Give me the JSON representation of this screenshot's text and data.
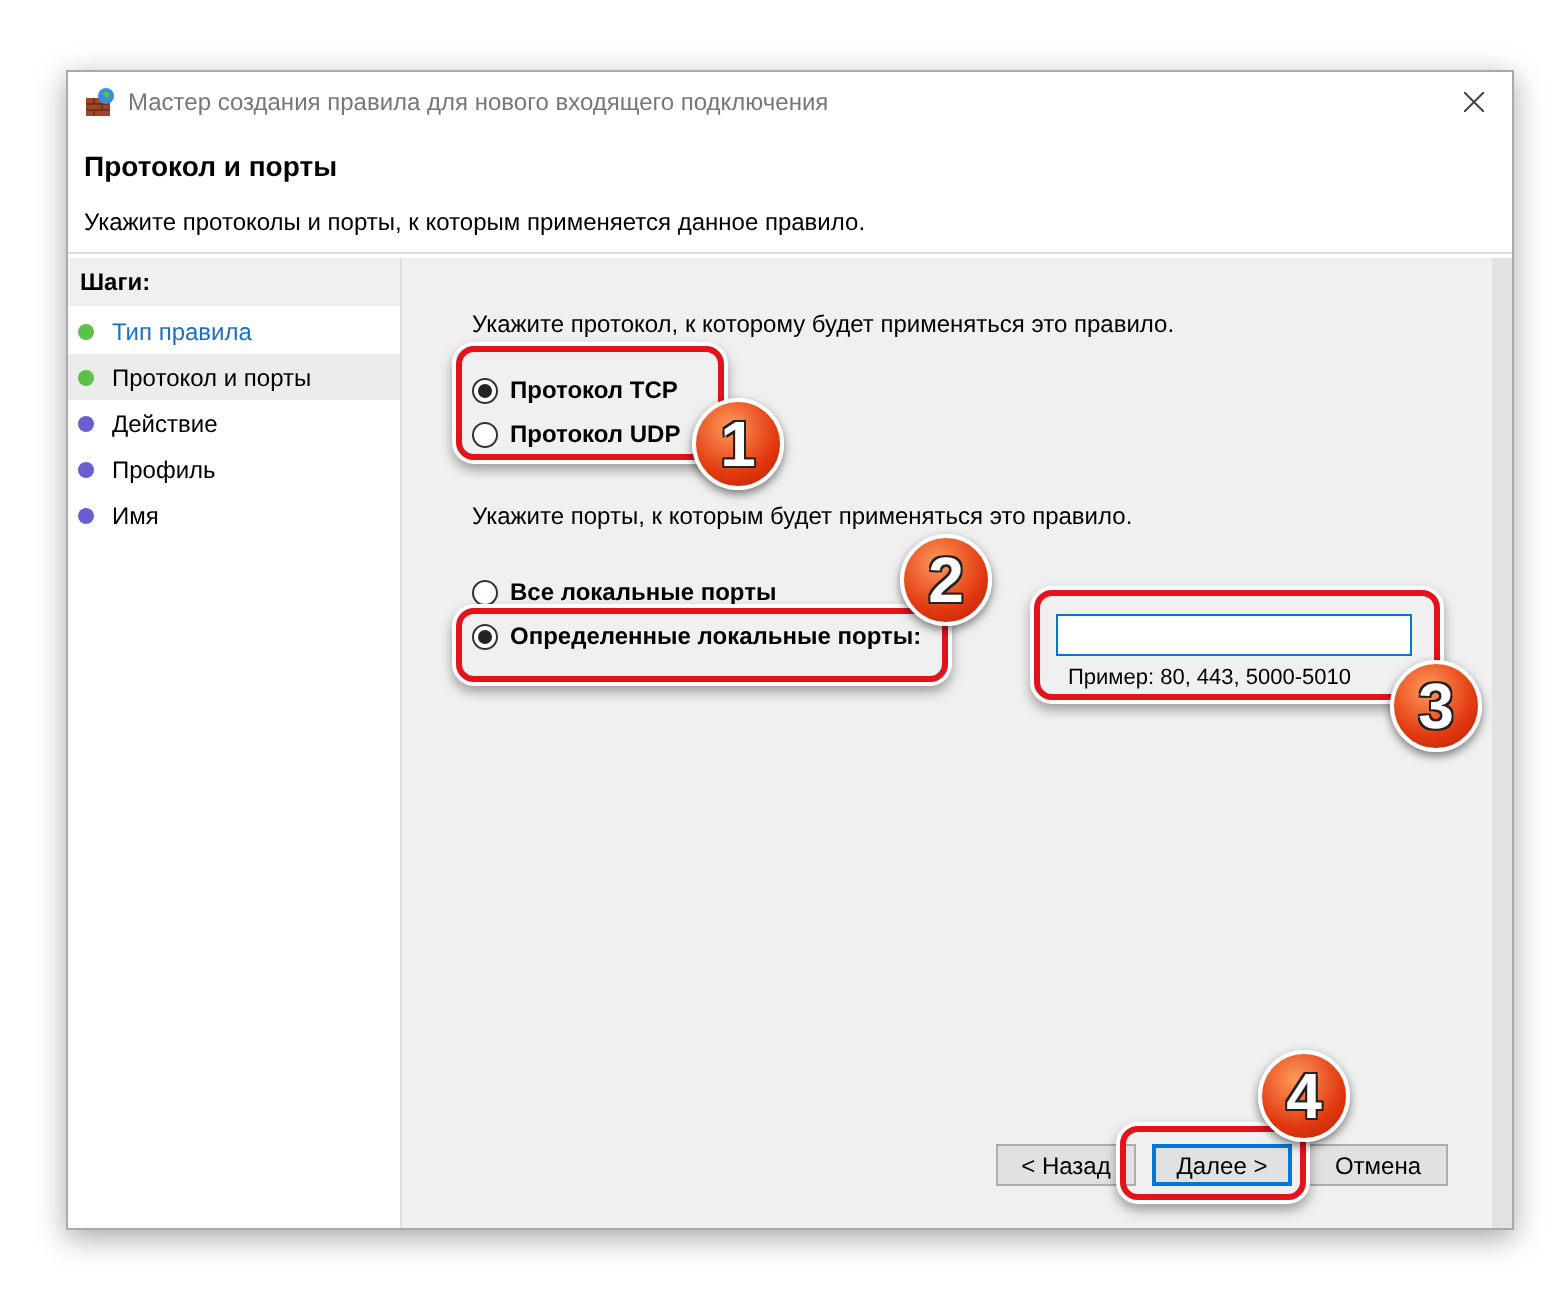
{
  "window": {
    "title": "Мастер создания правила для нового входящего подключения"
  },
  "header": {
    "title": "Протокол и порты",
    "subtitle": "Укажите протоколы и порты, к которым применяется данное правило."
  },
  "steps": {
    "heading": "Шаги:",
    "items": [
      {
        "label": "Тип правила",
        "kind": "link",
        "color": "#5cc14a",
        "selected": false
      },
      {
        "label": "Протокол и порты",
        "kind": "text",
        "color": "#5cc14a",
        "selected": true
      },
      {
        "label": "Действие",
        "kind": "text",
        "color": "#6a5fd0",
        "selected": false
      },
      {
        "label": "Профиль",
        "kind": "text",
        "color": "#6a5fd0",
        "selected": false
      },
      {
        "label": "Имя",
        "kind": "text",
        "color": "#6a5fd0",
        "selected": false
      }
    ]
  },
  "protocol": {
    "prompt": "Укажите протокол, к которому будет применяться это правило.",
    "options": [
      {
        "label": "Протокол TCP",
        "selected": true
      },
      {
        "label": "Протокол UDP",
        "selected": false
      }
    ]
  },
  "ports": {
    "prompt": "Укажите порты, к которым будет применяться это правило.",
    "options": [
      {
        "label": "Все локальные порты",
        "selected": false
      },
      {
        "label": "Определенные локальные порты:",
        "selected": true
      }
    ],
    "field": {
      "focused": true,
      "hint": "Пример: 80, 443, 5000-5010"
    }
  },
  "buttons": [
    {
      "label": "< Назад",
      "focused": false
    },
    {
      "label": "Далее >",
      "focused": true
    },
    {
      "label": "Отмена",
      "focused": false
    }
  ],
  "callouts": [
    "1",
    "2",
    "3",
    "4"
  ]
}
